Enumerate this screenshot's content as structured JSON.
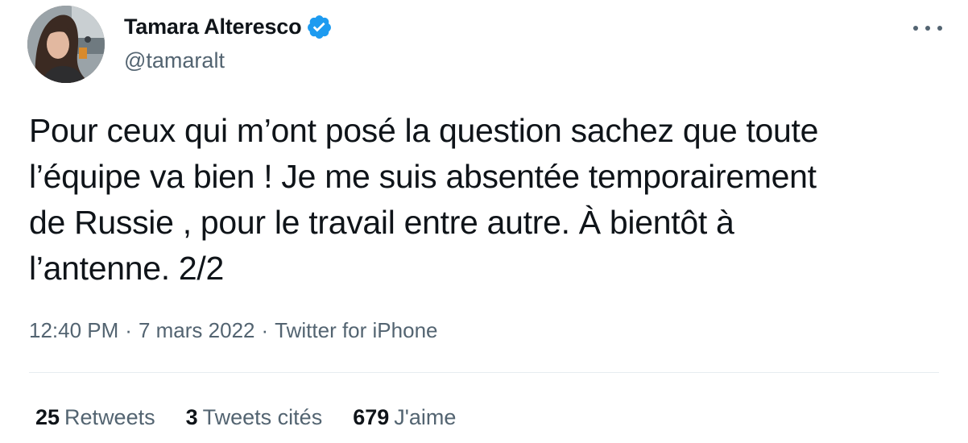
{
  "author": {
    "display_name": "Tamara Alteresco",
    "handle": "@tamaralt",
    "verified": true,
    "avatar": "profile-photo"
  },
  "tweet": {
    "lines": [
      "Pour ceux qui m’ont posé la question sachez que toute",
      "l’équipe va bien ! Je me suis absentée temporairement",
      "de Russie , pour le travail entre autre. À bientôt à",
      "l’antenne. 2/2"
    ]
  },
  "meta": {
    "time": "12:40 PM",
    "separator": "·",
    "date": "7 mars 2022",
    "source": "Twitter for iPhone"
  },
  "stats": {
    "retweets_count": "25",
    "retweets_label": "Retweets",
    "quotes_count": "3",
    "quotes_label": "Tweets cités",
    "likes_count": "679",
    "likes_label": "J'aime"
  },
  "colors": {
    "text_primary": "#0f1419",
    "text_secondary": "#536471",
    "verified_blue": "#1d9bf0",
    "divider": "#e6ecf0"
  },
  "icons": {
    "verified": "verified-badge-icon",
    "more": "more-horizontal-icon"
  }
}
